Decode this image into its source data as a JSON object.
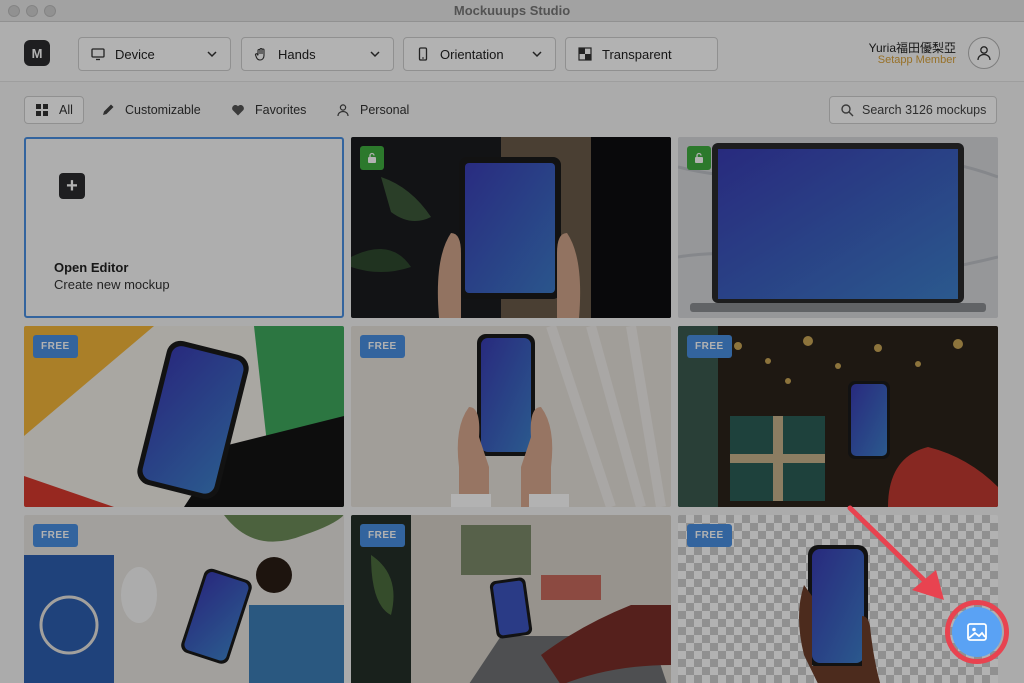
{
  "window": {
    "title": "Mockuuups Studio"
  },
  "toolbar": {
    "logo": "M",
    "dropdowns": [
      {
        "label": "Device",
        "icon": "monitor-icon"
      },
      {
        "label": "Hands",
        "icon": "hand-icon"
      },
      {
        "label": "Orientation",
        "icon": "phone-icon"
      },
      {
        "label": "Transparent",
        "icon": "checkerboard-icon"
      }
    ],
    "user": {
      "name": "Yuria福田優梨亞",
      "plan": "Setapp Member"
    }
  },
  "filters": {
    "tabs": [
      {
        "label": "All",
        "icon": "grid-icon",
        "active": true
      },
      {
        "label": "Customizable",
        "icon": "pencil-icon",
        "active": false
      },
      {
        "label": "Favorites",
        "icon": "heart-icon",
        "active": false
      },
      {
        "label": "Personal",
        "icon": "person-icon",
        "active": false
      }
    ],
    "search_placeholder": "Search 3126 mockups"
  },
  "editor_card": {
    "title": "Open Editor",
    "subtitle": "Create new mockup"
  },
  "mockups": [
    {
      "badge": "lock",
      "device": "tablet",
      "scene": "hands holding tablet near plant"
    },
    {
      "badge": "lock",
      "device": "laptop",
      "scene": "laptop on marble"
    },
    {
      "badge": "FREE",
      "device": "phone",
      "scene": "phone on colorful paper"
    },
    {
      "badge": "FREE",
      "device": "phone",
      "scene": "hands holding phone"
    },
    {
      "badge": "FREE",
      "device": "phone",
      "scene": "gift and phone with lights"
    },
    {
      "badge": "FREE",
      "device": "phone",
      "scene": "desk with notebook and phone"
    },
    {
      "badge": "FREE",
      "device": "phone",
      "scene": "hand on phone at desk"
    },
    {
      "badge": "FREE",
      "device": "phone",
      "scene": "hand holding phone transparent"
    }
  ],
  "fab": {
    "icon": "image-icon"
  },
  "colors": {
    "accent": "#4a90e2",
    "free_badge": "#4a90e2",
    "lock_badge": "#3fae3f",
    "highlight": "#e84350",
    "member": "#d9a23a"
  }
}
